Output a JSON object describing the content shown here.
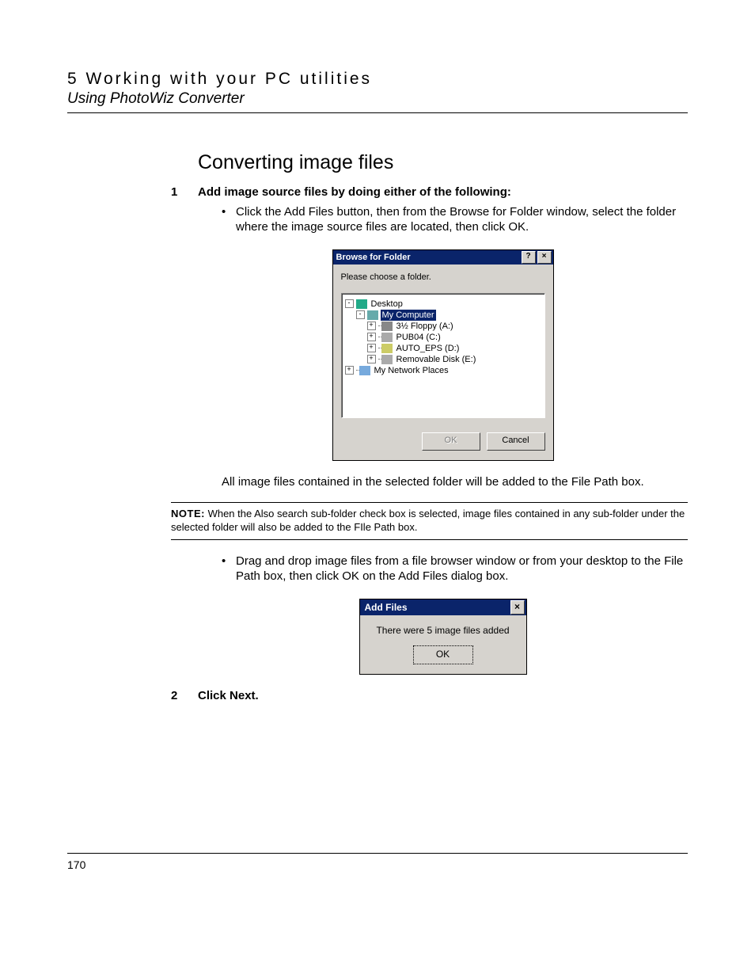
{
  "header": {
    "chapter": "5 Working with your PC utilities",
    "subtitle": "Using PhotoWiz Converter"
  },
  "section_title": "Converting image files",
  "step1": {
    "num": "1",
    "text": "Add image source files by doing either of the following:"
  },
  "bullet1": "Click the Add Files button, then from the Browse for Folder window, select the folder where the image source files are located, then click OK.",
  "bff": {
    "title": "Browse for Folder",
    "help": "?",
    "close": "×",
    "instruction": "Please choose a folder.",
    "tree": {
      "desktop": "Desktop",
      "my_computer": "My Computer",
      "floppy": "3½ Floppy (A:)",
      "pub04": "PUB04 (C:)",
      "auto_eps": "AUTO_EPS (D:)",
      "removable": "Removable Disk (E:)",
      "network": "My Network Places"
    },
    "ok": "OK",
    "cancel": "Cancel"
  },
  "after_fig1": "All image files contained in the selected folder will be added to the File Path box.",
  "note": {
    "label": "NOTE:",
    "text": "When the Also search sub-folder check box is selected, image files contained in any sub-folder under the selected folder will also be added to the FIle Path box."
  },
  "bullet2": "Drag and drop image files from a file browser window or from your desktop to the File Path box, then click OK on the Add Files dialog box.",
  "af": {
    "title": "Add Files",
    "close": "×",
    "message": "There were 5 image files added",
    "ok": "OK"
  },
  "step2": {
    "num": "2",
    "text": "Click Next."
  },
  "page_number": "170"
}
